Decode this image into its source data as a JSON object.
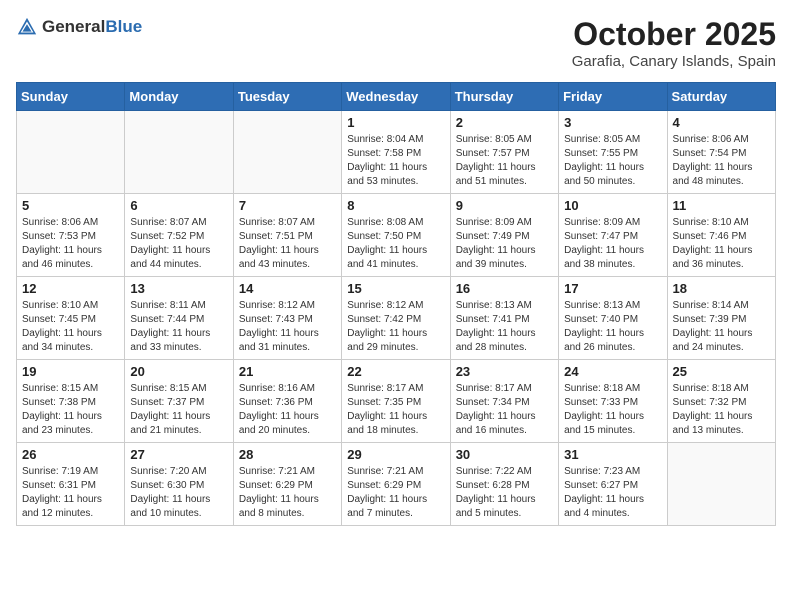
{
  "header": {
    "logo_general": "General",
    "logo_blue": "Blue",
    "month": "October 2025",
    "location": "Garafia, Canary Islands, Spain"
  },
  "weekdays": [
    "Sunday",
    "Monday",
    "Tuesday",
    "Wednesday",
    "Thursday",
    "Friday",
    "Saturday"
  ],
  "weeks": [
    [
      {
        "day": "",
        "info": ""
      },
      {
        "day": "",
        "info": ""
      },
      {
        "day": "",
        "info": ""
      },
      {
        "day": "1",
        "info": "Sunrise: 8:04 AM\nSunset: 7:58 PM\nDaylight: 11 hours and 53 minutes."
      },
      {
        "day": "2",
        "info": "Sunrise: 8:05 AM\nSunset: 7:57 PM\nDaylight: 11 hours and 51 minutes."
      },
      {
        "day": "3",
        "info": "Sunrise: 8:05 AM\nSunset: 7:55 PM\nDaylight: 11 hours and 50 minutes."
      },
      {
        "day": "4",
        "info": "Sunrise: 8:06 AM\nSunset: 7:54 PM\nDaylight: 11 hours and 48 minutes."
      }
    ],
    [
      {
        "day": "5",
        "info": "Sunrise: 8:06 AM\nSunset: 7:53 PM\nDaylight: 11 hours and 46 minutes."
      },
      {
        "day": "6",
        "info": "Sunrise: 8:07 AM\nSunset: 7:52 PM\nDaylight: 11 hours and 44 minutes."
      },
      {
        "day": "7",
        "info": "Sunrise: 8:07 AM\nSunset: 7:51 PM\nDaylight: 11 hours and 43 minutes."
      },
      {
        "day": "8",
        "info": "Sunrise: 8:08 AM\nSunset: 7:50 PM\nDaylight: 11 hours and 41 minutes."
      },
      {
        "day": "9",
        "info": "Sunrise: 8:09 AM\nSunset: 7:49 PM\nDaylight: 11 hours and 39 minutes."
      },
      {
        "day": "10",
        "info": "Sunrise: 8:09 AM\nSunset: 7:47 PM\nDaylight: 11 hours and 38 minutes."
      },
      {
        "day": "11",
        "info": "Sunrise: 8:10 AM\nSunset: 7:46 PM\nDaylight: 11 hours and 36 minutes."
      }
    ],
    [
      {
        "day": "12",
        "info": "Sunrise: 8:10 AM\nSunset: 7:45 PM\nDaylight: 11 hours and 34 minutes."
      },
      {
        "day": "13",
        "info": "Sunrise: 8:11 AM\nSunset: 7:44 PM\nDaylight: 11 hours and 33 minutes."
      },
      {
        "day": "14",
        "info": "Sunrise: 8:12 AM\nSunset: 7:43 PM\nDaylight: 11 hours and 31 minutes."
      },
      {
        "day": "15",
        "info": "Sunrise: 8:12 AM\nSunset: 7:42 PM\nDaylight: 11 hours and 29 minutes."
      },
      {
        "day": "16",
        "info": "Sunrise: 8:13 AM\nSunset: 7:41 PM\nDaylight: 11 hours and 28 minutes."
      },
      {
        "day": "17",
        "info": "Sunrise: 8:13 AM\nSunset: 7:40 PM\nDaylight: 11 hours and 26 minutes."
      },
      {
        "day": "18",
        "info": "Sunrise: 8:14 AM\nSunset: 7:39 PM\nDaylight: 11 hours and 24 minutes."
      }
    ],
    [
      {
        "day": "19",
        "info": "Sunrise: 8:15 AM\nSunset: 7:38 PM\nDaylight: 11 hours and 23 minutes."
      },
      {
        "day": "20",
        "info": "Sunrise: 8:15 AM\nSunset: 7:37 PM\nDaylight: 11 hours and 21 minutes."
      },
      {
        "day": "21",
        "info": "Sunrise: 8:16 AM\nSunset: 7:36 PM\nDaylight: 11 hours and 20 minutes."
      },
      {
        "day": "22",
        "info": "Sunrise: 8:17 AM\nSunset: 7:35 PM\nDaylight: 11 hours and 18 minutes."
      },
      {
        "day": "23",
        "info": "Sunrise: 8:17 AM\nSunset: 7:34 PM\nDaylight: 11 hours and 16 minutes."
      },
      {
        "day": "24",
        "info": "Sunrise: 8:18 AM\nSunset: 7:33 PM\nDaylight: 11 hours and 15 minutes."
      },
      {
        "day": "25",
        "info": "Sunrise: 8:18 AM\nSunset: 7:32 PM\nDaylight: 11 hours and 13 minutes."
      }
    ],
    [
      {
        "day": "26",
        "info": "Sunrise: 7:19 AM\nSunset: 6:31 PM\nDaylight: 11 hours and 12 minutes."
      },
      {
        "day": "27",
        "info": "Sunrise: 7:20 AM\nSunset: 6:30 PM\nDaylight: 11 hours and 10 minutes."
      },
      {
        "day": "28",
        "info": "Sunrise: 7:21 AM\nSunset: 6:29 PM\nDaylight: 11 hours and 8 minutes."
      },
      {
        "day": "29",
        "info": "Sunrise: 7:21 AM\nSunset: 6:29 PM\nDaylight: 11 hours and 7 minutes."
      },
      {
        "day": "30",
        "info": "Sunrise: 7:22 AM\nSunset: 6:28 PM\nDaylight: 11 hours and 5 minutes."
      },
      {
        "day": "31",
        "info": "Sunrise: 7:23 AM\nSunset: 6:27 PM\nDaylight: 11 hours and 4 minutes."
      },
      {
        "day": "",
        "info": ""
      }
    ]
  ]
}
